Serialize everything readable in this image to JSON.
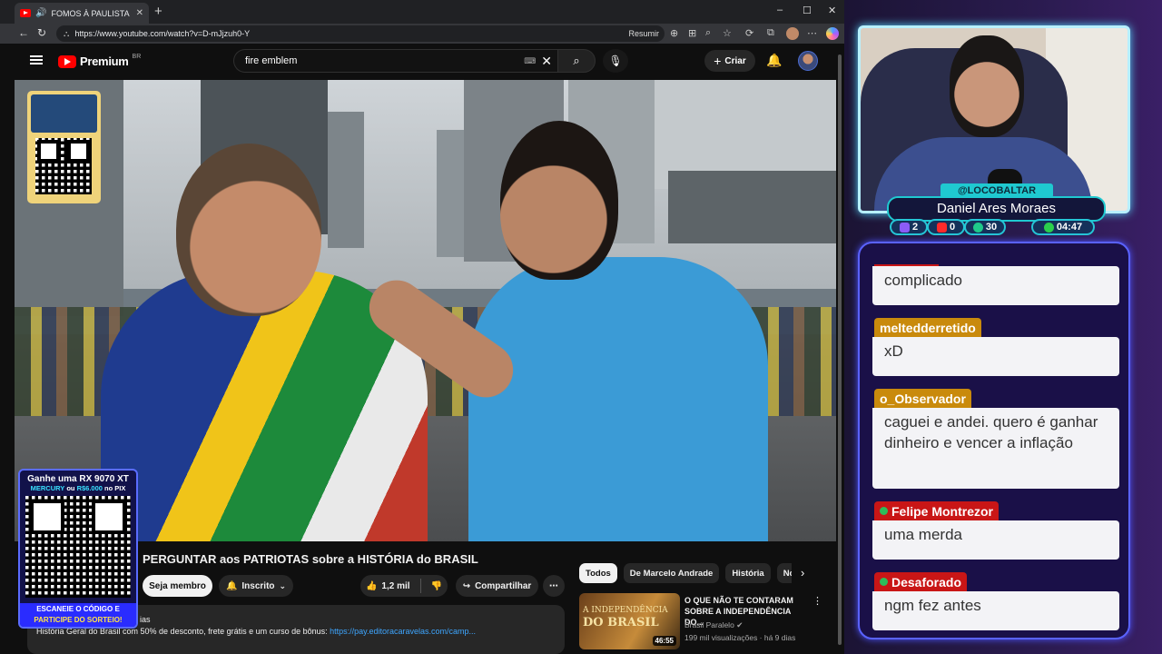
{
  "browser": {
    "tab_title": "FOMOS À PAULISTA PERGUNTAR",
    "url": "https://www.youtube.com/watch?v=D-mJjzuh0-Y",
    "resumir": "Resumir",
    "window_controls": {
      "minimize": "–",
      "maximize": "☐",
      "close": "✕"
    }
  },
  "youtube": {
    "logo_text": "Premium",
    "country": "BR",
    "search_query": "fire emblem",
    "create_label": "Criar",
    "video_title": "PERGUNTAR aos PATRIOTAS sobre a HISTÓRIA do BRASIL",
    "join_label": "Seja membro",
    "subscribed_label": "Inscrito",
    "like_count": "1,2 mil",
    "share_label": "Compartilhar",
    "description_fragment": "ias",
    "description_text": "História Geral do Brasil com 50% de desconto, frete grátis e um curso de bônus: ",
    "description_link": "https://pay.editoracaravelas.com/camp...",
    "chips": [
      "Todos",
      "De Marcelo Andrade",
      "História",
      "Notícias"
    ],
    "recommendation": {
      "thumb_line1": "A INDEPENDÊNCIA",
      "thumb_line2": "DO BRASIL",
      "duration": "46:55",
      "title": "O QUE NÃO TE CONTARAM SOBRE A INDEPENDÊNCIA DO...",
      "channel": "Brasil Paralelo",
      "meta": "199 mil visualizações · há 9 dias"
    }
  },
  "promo": {
    "headline": "Ganhe uma RX 9070 XT",
    "sub_part1": "MERCURY",
    "sub_or": " ou ",
    "sub_part2": "R$6.000",
    "sub_suffix": " no PIX",
    "footer_line1": "ESCANEIE O CÓDIGO E",
    "footer_line2": "PARTICIPE DO SORTEIO!"
  },
  "stream": {
    "handle": "@LOCOBALTAR",
    "streamer_name": "Daniel Ares Moraes",
    "stats": {
      "chat": "2",
      "youtube": "0",
      "viewers": "30",
      "timer": "04:47"
    }
  },
  "chat": [
    {
      "user": "",
      "message": "complicado"
    },
    {
      "user": "meltedderretido",
      "message": "xD"
    },
    {
      "user": "o_Observador",
      "message": "caguei e andei. quero é ganhar dinheiro e vencer a inflação"
    },
    {
      "user": "Felipe Montrezor",
      "message": "uma merda"
    },
    {
      "user": "Desaforado",
      "message": "ngm fez antes"
    }
  ],
  "colors": {
    "youtube_red": "#ff0000",
    "accent_cyan": "#1fc9d0",
    "chat_gold": "#c98a0c",
    "chat_red": "#c91616"
  }
}
